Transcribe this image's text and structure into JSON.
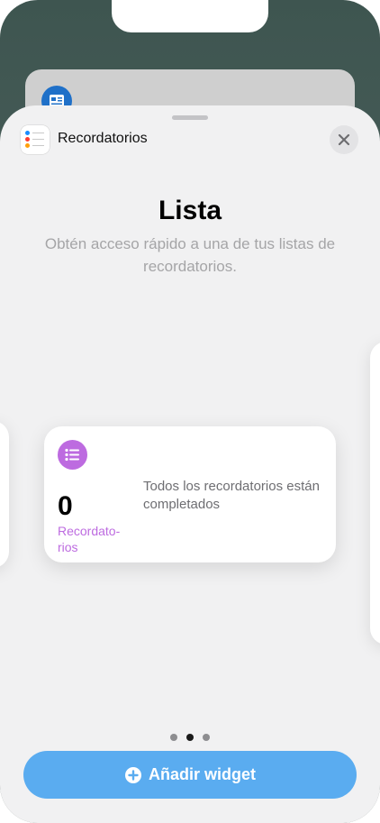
{
  "sheet": {
    "app_name": "Recordatorios",
    "title": "Lista",
    "subtitle": "Obtén acceso rápido a una de tus listas de recordatorios."
  },
  "widget": {
    "count": "0",
    "label": "Recordato-rios",
    "message": "Todos los recordatorios están completados",
    "accent_color": "#bd6be0"
  },
  "pager": {
    "pages": 3,
    "current": 2
  },
  "actions": {
    "add_widget_label": "Añadir widget",
    "button_color": "#5aacf0"
  },
  "icons": {
    "app": "reminders-app-icon",
    "close": "close-icon",
    "widget": "list-icon",
    "add": "plus-circle-icon",
    "background_card": "news-app-icon"
  }
}
